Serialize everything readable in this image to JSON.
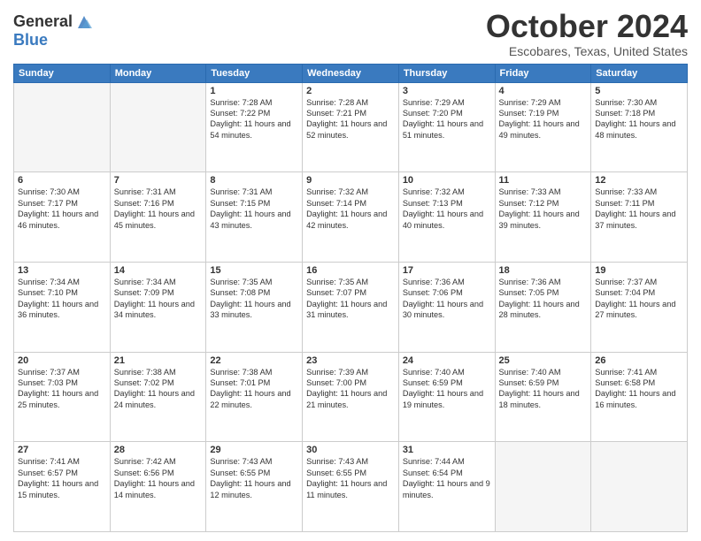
{
  "header": {
    "logo_line1": "General",
    "logo_line2": "Blue",
    "title": "October 2024",
    "subtitle": "Escobares, Texas, United States"
  },
  "days_of_week": [
    "Sunday",
    "Monday",
    "Tuesday",
    "Wednesday",
    "Thursday",
    "Friday",
    "Saturday"
  ],
  "weeks": [
    [
      {
        "day": "",
        "sunrise": "",
        "sunset": "",
        "daylight": ""
      },
      {
        "day": "",
        "sunrise": "",
        "sunset": "",
        "daylight": ""
      },
      {
        "day": "1",
        "sunrise": "Sunrise: 7:28 AM",
        "sunset": "Sunset: 7:22 PM",
        "daylight": "Daylight: 11 hours and 54 minutes."
      },
      {
        "day": "2",
        "sunrise": "Sunrise: 7:28 AM",
        "sunset": "Sunset: 7:21 PM",
        "daylight": "Daylight: 11 hours and 52 minutes."
      },
      {
        "day": "3",
        "sunrise": "Sunrise: 7:29 AM",
        "sunset": "Sunset: 7:20 PM",
        "daylight": "Daylight: 11 hours and 51 minutes."
      },
      {
        "day": "4",
        "sunrise": "Sunrise: 7:29 AM",
        "sunset": "Sunset: 7:19 PM",
        "daylight": "Daylight: 11 hours and 49 minutes."
      },
      {
        "day": "5",
        "sunrise": "Sunrise: 7:30 AM",
        "sunset": "Sunset: 7:18 PM",
        "daylight": "Daylight: 11 hours and 48 minutes."
      }
    ],
    [
      {
        "day": "6",
        "sunrise": "Sunrise: 7:30 AM",
        "sunset": "Sunset: 7:17 PM",
        "daylight": "Daylight: 11 hours and 46 minutes."
      },
      {
        "day": "7",
        "sunrise": "Sunrise: 7:31 AM",
        "sunset": "Sunset: 7:16 PM",
        "daylight": "Daylight: 11 hours and 45 minutes."
      },
      {
        "day": "8",
        "sunrise": "Sunrise: 7:31 AM",
        "sunset": "Sunset: 7:15 PM",
        "daylight": "Daylight: 11 hours and 43 minutes."
      },
      {
        "day": "9",
        "sunrise": "Sunrise: 7:32 AM",
        "sunset": "Sunset: 7:14 PM",
        "daylight": "Daylight: 11 hours and 42 minutes."
      },
      {
        "day": "10",
        "sunrise": "Sunrise: 7:32 AM",
        "sunset": "Sunset: 7:13 PM",
        "daylight": "Daylight: 11 hours and 40 minutes."
      },
      {
        "day": "11",
        "sunrise": "Sunrise: 7:33 AM",
        "sunset": "Sunset: 7:12 PM",
        "daylight": "Daylight: 11 hours and 39 minutes."
      },
      {
        "day": "12",
        "sunrise": "Sunrise: 7:33 AM",
        "sunset": "Sunset: 7:11 PM",
        "daylight": "Daylight: 11 hours and 37 minutes."
      }
    ],
    [
      {
        "day": "13",
        "sunrise": "Sunrise: 7:34 AM",
        "sunset": "Sunset: 7:10 PM",
        "daylight": "Daylight: 11 hours and 36 minutes."
      },
      {
        "day": "14",
        "sunrise": "Sunrise: 7:34 AM",
        "sunset": "Sunset: 7:09 PM",
        "daylight": "Daylight: 11 hours and 34 minutes."
      },
      {
        "day": "15",
        "sunrise": "Sunrise: 7:35 AM",
        "sunset": "Sunset: 7:08 PM",
        "daylight": "Daylight: 11 hours and 33 minutes."
      },
      {
        "day": "16",
        "sunrise": "Sunrise: 7:35 AM",
        "sunset": "Sunset: 7:07 PM",
        "daylight": "Daylight: 11 hours and 31 minutes."
      },
      {
        "day": "17",
        "sunrise": "Sunrise: 7:36 AM",
        "sunset": "Sunset: 7:06 PM",
        "daylight": "Daylight: 11 hours and 30 minutes."
      },
      {
        "day": "18",
        "sunrise": "Sunrise: 7:36 AM",
        "sunset": "Sunset: 7:05 PM",
        "daylight": "Daylight: 11 hours and 28 minutes."
      },
      {
        "day": "19",
        "sunrise": "Sunrise: 7:37 AM",
        "sunset": "Sunset: 7:04 PM",
        "daylight": "Daylight: 11 hours and 27 minutes."
      }
    ],
    [
      {
        "day": "20",
        "sunrise": "Sunrise: 7:37 AM",
        "sunset": "Sunset: 7:03 PM",
        "daylight": "Daylight: 11 hours and 25 minutes."
      },
      {
        "day": "21",
        "sunrise": "Sunrise: 7:38 AM",
        "sunset": "Sunset: 7:02 PM",
        "daylight": "Daylight: 11 hours and 24 minutes."
      },
      {
        "day": "22",
        "sunrise": "Sunrise: 7:38 AM",
        "sunset": "Sunset: 7:01 PM",
        "daylight": "Daylight: 11 hours and 22 minutes."
      },
      {
        "day": "23",
        "sunrise": "Sunrise: 7:39 AM",
        "sunset": "Sunset: 7:00 PM",
        "daylight": "Daylight: 11 hours and 21 minutes."
      },
      {
        "day": "24",
        "sunrise": "Sunrise: 7:40 AM",
        "sunset": "Sunset: 6:59 PM",
        "daylight": "Daylight: 11 hours and 19 minutes."
      },
      {
        "day": "25",
        "sunrise": "Sunrise: 7:40 AM",
        "sunset": "Sunset: 6:59 PM",
        "daylight": "Daylight: 11 hours and 18 minutes."
      },
      {
        "day": "26",
        "sunrise": "Sunrise: 7:41 AM",
        "sunset": "Sunset: 6:58 PM",
        "daylight": "Daylight: 11 hours and 16 minutes."
      }
    ],
    [
      {
        "day": "27",
        "sunrise": "Sunrise: 7:41 AM",
        "sunset": "Sunset: 6:57 PM",
        "daylight": "Daylight: 11 hours and 15 minutes."
      },
      {
        "day": "28",
        "sunrise": "Sunrise: 7:42 AM",
        "sunset": "Sunset: 6:56 PM",
        "daylight": "Daylight: 11 hours and 14 minutes."
      },
      {
        "day": "29",
        "sunrise": "Sunrise: 7:43 AM",
        "sunset": "Sunset: 6:55 PM",
        "daylight": "Daylight: 11 hours and 12 minutes."
      },
      {
        "day": "30",
        "sunrise": "Sunrise: 7:43 AM",
        "sunset": "Sunset: 6:55 PM",
        "daylight": "Daylight: 11 hours and 11 minutes."
      },
      {
        "day": "31",
        "sunrise": "Sunrise: 7:44 AM",
        "sunset": "Sunset: 6:54 PM",
        "daylight": "Daylight: 11 hours and 9 minutes."
      },
      {
        "day": "",
        "sunrise": "",
        "sunset": "",
        "daylight": ""
      },
      {
        "day": "",
        "sunrise": "",
        "sunset": "",
        "daylight": ""
      }
    ]
  ]
}
